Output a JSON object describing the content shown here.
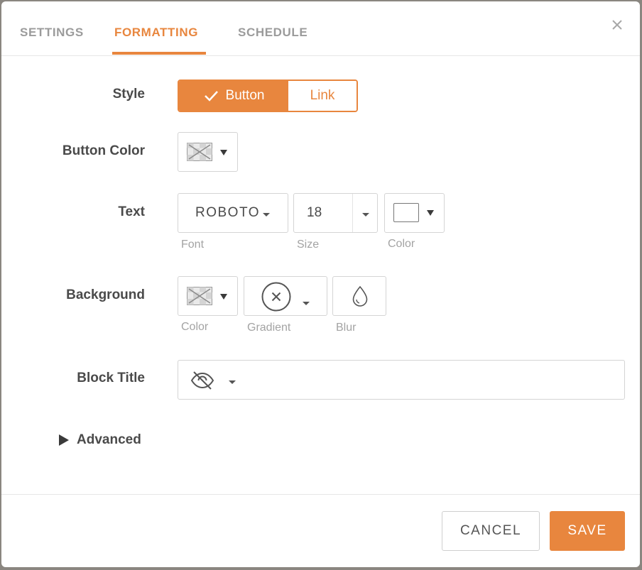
{
  "tabs": [
    {
      "label": "SETTINGS",
      "active": false
    },
    {
      "label": "FORMATTING",
      "active": true
    },
    {
      "label": "SCHEDULE",
      "active": false
    }
  ],
  "close_icon": "close-x-icon",
  "style": {
    "label": "Style",
    "options": [
      "Button",
      "Link"
    ],
    "selected": "Button",
    "check_icon": "checkmark-icon"
  },
  "button_color": {
    "label": "Button Color",
    "value": "none",
    "swatch_icon": "no-color-swatch-icon"
  },
  "text": {
    "label": "Text",
    "font": {
      "value": "ROBOTO",
      "label": "Font"
    },
    "size": {
      "value": "18",
      "label": "Size"
    },
    "color": {
      "value": "#ffffff",
      "label": "Color"
    }
  },
  "background": {
    "label": "Background",
    "color": {
      "label": "Color",
      "value": "none"
    },
    "gradient": {
      "label": "Gradient",
      "icon": "circle-x-icon"
    },
    "blur": {
      "label": "Blur",
      "icon": "droplet-icon"
    }
  },
  "block_title": {
    "label": "Block Title",
    "visibility_icon": "eye-slash-icon",
    "value": "",
    "placeholder": ""
  },
  "advanced": {
    "label": "Advanced",
    "icon": "triangle-right-icon"
  },
  "footer": {
    "cancel_label": "CANCEL",
    "save_label": "SAVE"
  },
  "colors": {
    "accent": "#e8863e",
    "text": "#4a4a4a",
    "muted": "#a3a3a3",
    "border": "#d4d4d4"
  }
}
